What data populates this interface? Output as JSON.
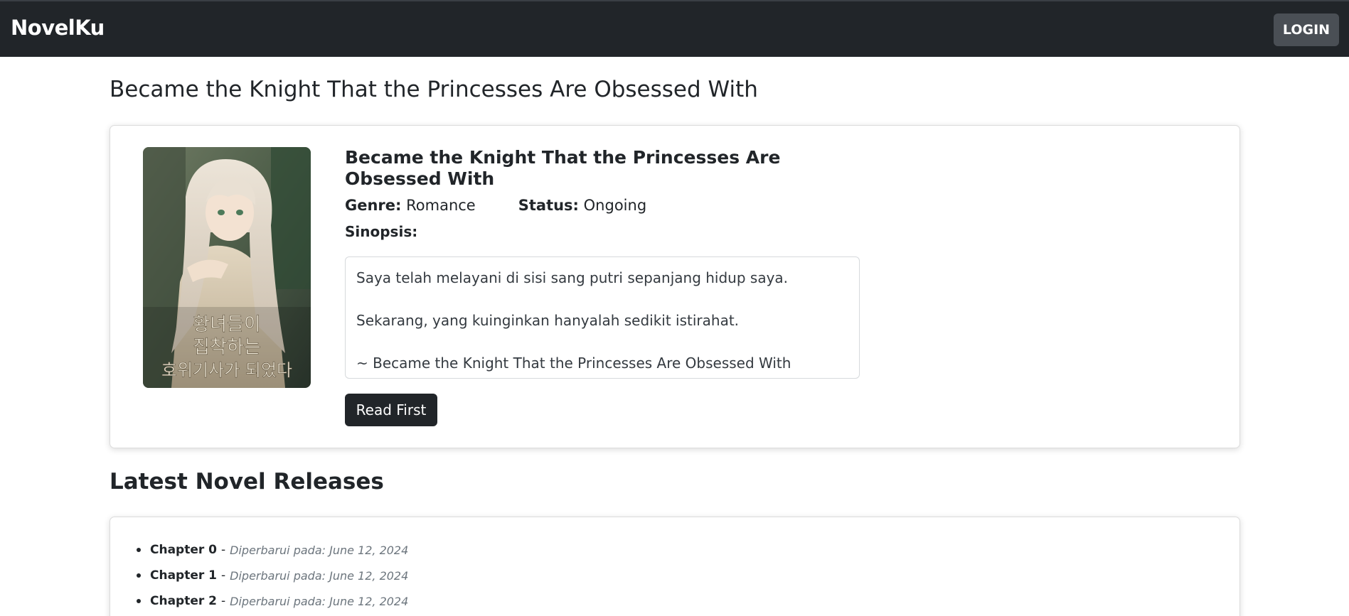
{
  "navbar": {
    "brand": "NovelKu",
    "login_label": "LOGIN"
  },
  "page_title": "Became the Knight That the Princesses Are Obsessed With",
  "novel": {
    "title": "Became the Knight That the Princesses Are Obsessed With",
    "genre_label": "Genre:",
    "genre": "Romance",
    "status_label": "Status:",
    "status": "Ongoing",
    "sinopsis_label": "Sinopsis:",
    "sinopsis": [
      "Saya telah melayani di sisi sang putri sepanjang hidup saya.",
      "Sekarang, yang kuinginkan hanyalah sedikit istirahat.",
      "~ Became the Knight That the Princesses Are Obsessed With"
    ],
    "read_button": "Read First",
    "cover_text": "황녀들이 집착하는 호위기사가 되었다"
  },
  "latest_section_title": "Latest Novel Releases",
  "chapters": [
    {
      "name": "Chapter 0",
      "separator": "-",
      "date": "Diperbarui pada: June 12, 2024"
    },
    {
      "name": "Chapter 1",
      "separator": "-",
      "date": "Diperbarui pada: June 12, 2024"
    },
    {
      "name": "Chapter 2",
      "separator": "-",
      "date": "Diperbarui pada: June 12, 2024"
    }
  ],
  "colors": {
    "navbar_bg": "#212529",
    "login_bg": "#4a4f55",
    "button_dark": "#212529",
    "date_text": "#6c757d"
  }
}
